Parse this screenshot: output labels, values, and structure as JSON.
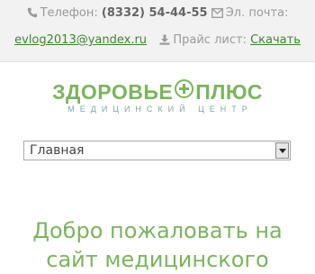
{
  "contacts": {
    "phone_label": "Телефон:",
    "phone_number": "(8332) 54-44-55",
    "email_label": "Эл. почта:",
    "email": "evlog2013@yandex.ru",
    "pricelist_label": "Прайс лист:",
    "download_link": "Скачать"
  },
  "logo": {
    "part1": "ЗДОРОВЬЕ",
    "part2": "ПЛЮС",
    "subtitle": "МЕДИЦИНСКИЙ ЦЕНТР"
  },
  "nav": {
    "selected": "Главная"
  },
  "main": {
    "welcome_line1": "Добро пожаловать на",
    "welcome_line2": "сайт медицинского"
  },
  "colors": {
    "accent_green": "#7ab55c",
    "link_green": "#3a8a2a"
  },
  "icons": [
    "phone-icon",
    "envelope-icon",
    "download-icon",
    "cross-icon"
  ]
}
